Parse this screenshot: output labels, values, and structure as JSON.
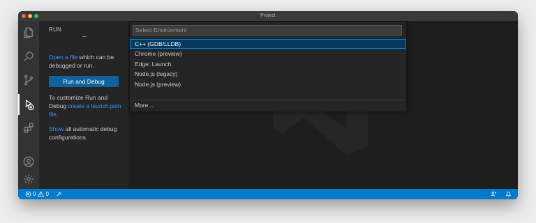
{
  "window": {
    "title": "Project"
  },
  "activity_bar": {
    "items": [
      {
        "name": "explorer-icon"
      },
      {
        "name": "search-icon"
      },
      {
        "name": "source-control-icon"
      },
      {
        "name": "run-debug-icon",
        "active": true
      },
      {
        "name": "extensions-icon"
      },
      {
        "name": "accounts-icon"
      },
      {
        "name": "settings-gear-icon"
      }
    ]
  },
  "sidebar": {
    "title": "RUN",
    "open_file_link": "Open a file",
    "open_file_rest": " which can be debugged or run.",
    "run_button": "Run and Debug",
    "customize_text": "To customize Run and Debug ",
    "create_link": "create a launch.json file",
    "customize_end": ".",
    "show_link": "Show",
    "show_rest": " all automatic debug configurations."
  },
  "quick_pick": {
    "placeholder": "Select Environment",
    "items": [
      {
        "label": "C++ (GDB/LLDB)",
        "selected": true
      },
      {
        "label": "Chrome (preview)"
      },
      {
        "label": "Edge: Launch"
      },
      {
        "label": "Node.js (legacy)"
      },
      {
        "label": "Node.js (preview)"
      }
    ],
    "more": "More..."
  },
  "status_bar": {
    "errors": "0",
    "warnings": "0"
  },
  "colors": {
    "accent": "#007acc",
    "selection": "#04395e",
    "link": "#3794ff"
  }
}
